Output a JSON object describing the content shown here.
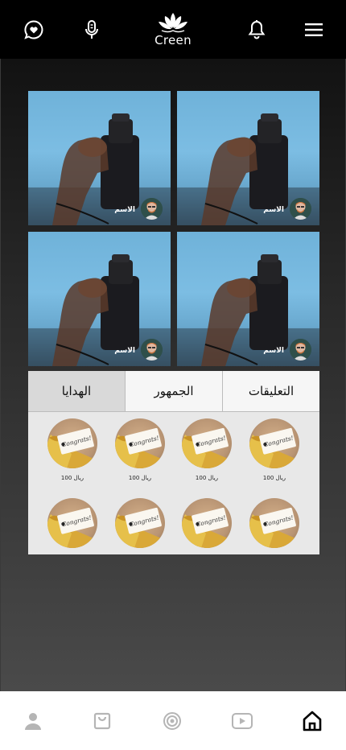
{
  "header": {
    "brand": "Creen",
    "icons": [
      "heart-chat-icon",
      "microphone-icon",
      "lotus-logo",
      "bell-icon",
      "menu-icon"
    ]
  },
  "streams": [
    {
      "name": "الاسم"
    },
    {
      "name": "الاسم"
    },
    {
      "name": "الاسم"
    },
    {
      "name": "الاسم"
    }
  ],
  "tabs": [
    {
      "label": "الهدايا",
      "active": true
    },
    {
      "label": "الجمهور",
      "active": false
    },
    {
      "label": "التعليقات",
      "active": false
    }
  ],
  "gifts": {
    "card_text": "Congrats!",
    "row1": [
      {
        "price": "100 ريال"
      },
      {
        "price": "100 ريال"
      },
      {
        "price": "100 ريال"
      },
      {
        "price": "100 ريال"
      }
    ],
    "row2": [
      {
        "price": ""
      },
      {
        "price": ""
      },
      {
        "price": ""
      },
      {
        "price": ""
      }
    ]
  },
  "bottom_nav": {
    "items": [
      "profile-icon",
      "shopping-bag-icon",
      "target-icon",
      "play-video-icon",
      "home-icon"
    ],
    "active": "home-icon"
  },
  "colors": {
    "topbar_bg": "#000000",
    "panel_bg": "#e8e8e8",
    "active_tab": "#d9d9d9",
    "nav_inactive": "#b5b5b5",
    "nav_active": "#000000"
  }
}
